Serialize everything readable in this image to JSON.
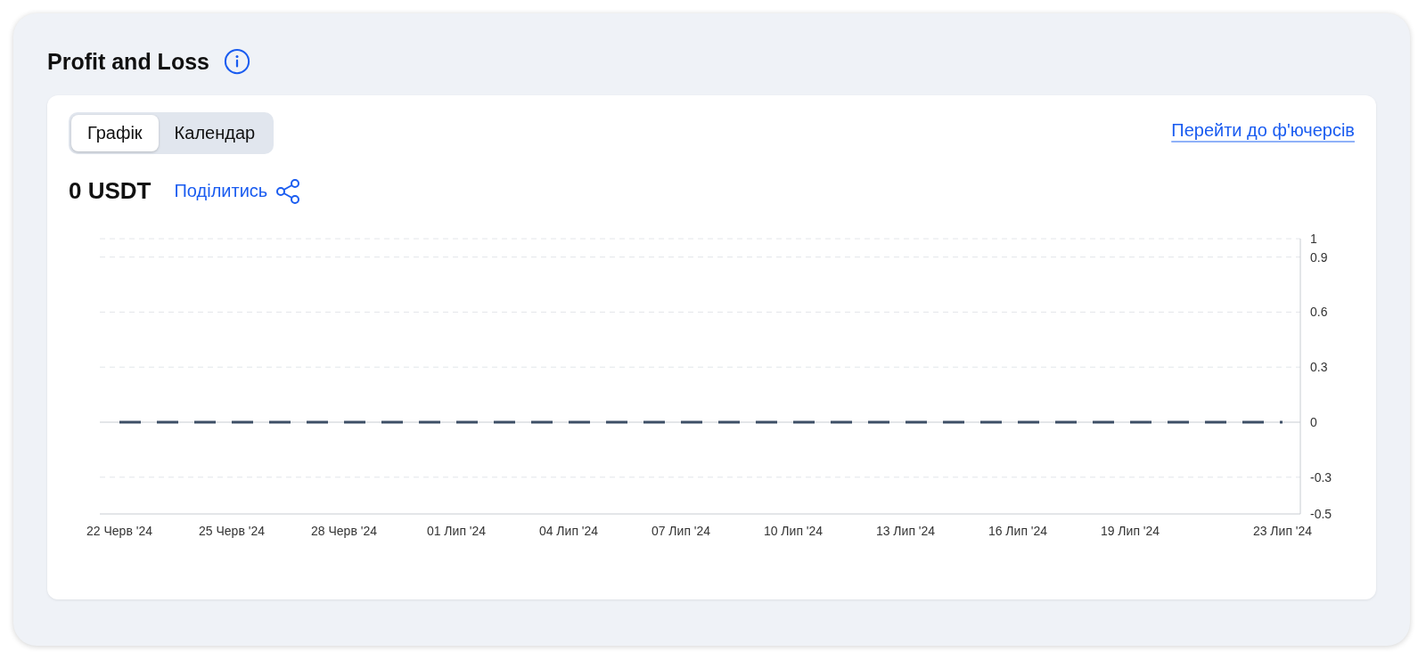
{
  "title": "Profit and Loss",
  "tabs": [
    {
      "label": "Графік",
      "selected": true
    },
    {
      "label": "Календар",
      "selected": false
    }
  ],
  "futures_link": "Перейти до ф'ючерсів",
  "total": "0 USDT",
  "share": "Поділитись",
  "chart_data": {
    "type": "line",
    "categories": [
      "22 Черв '24",
      "25 Черв '24",
      "28 Черв '24",
      "01 Лип '24",
      "04 Лип '24",
      "07 Лип '24",
      "10 Лип '24",
      "13 Лип '24",
      "16 Лип '24",
      "19 Лип '24",
      "23 Лип '24"
    ],
    "series": [
      {
        "color": "#3d4f66",
        "line_style": "dashed",
        "values": [
          0,
          0,
          0,
          0,
          0,
          0,
          0,
          0,
          0,
          0,
          0
        ]
      }
    ],
    "grid": true,
    "ylim": [
      -0.5,
      1
    ],
    "yticks": [
      1,
      0.9,
      0.6,
      0.3,
      0,
      -0.3,
      -0.5
    ]
  }
}
